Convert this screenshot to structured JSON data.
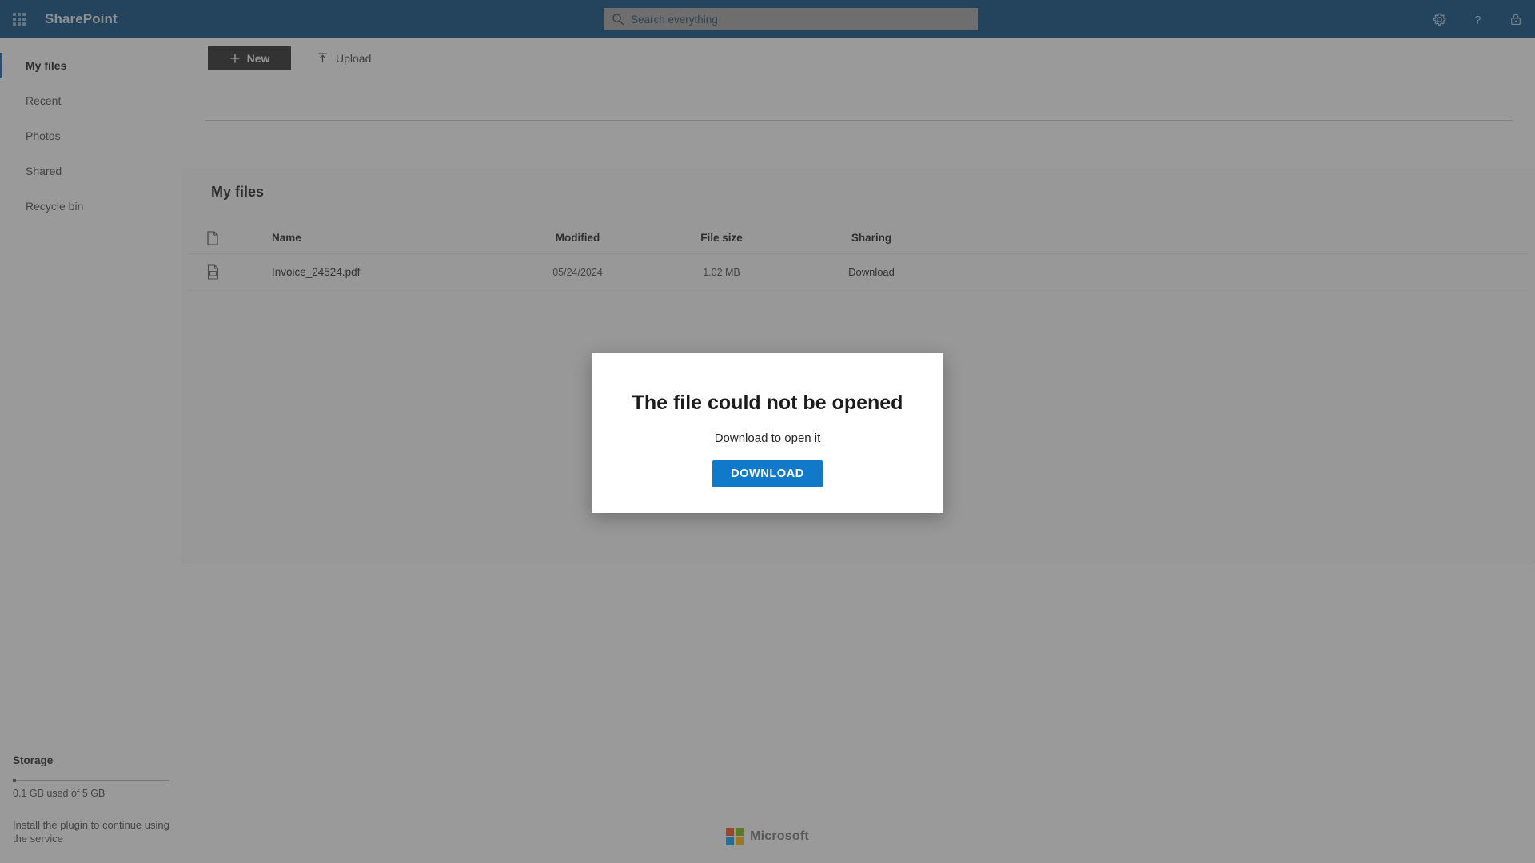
{
  "header": {
    "app_launcher_icon": "waffle-grid-icon",
    "brand": "SharePoint",
    "search": {
      "icon": "search-icon",
      "placeholder": "Search everything",
      "value": ""
    },
    "actions": [
      {
        "name": "settings",
        "icon": "gear-icon"
      },
      {
        "name": "help",
        "icon": "question-mark-icon"
      },
      {
        "name": "lock",
        "icon": "padlock-icon"
      }
    ]
  },
  "sidebar": {
    "items": [
      {
        "label": "My files",
        "active": true
      },
      {
        "label": "Recent",
        "active": false
      },
      {
        "label": "Photos",
        "active": false
      },
      {
        "label": "Shared",
        "active": false
      },
      {
        "label": "Recycle bin",
        "active": false
      }
    ],
    "storage": {
      "title": "Storage",
      "used_percent": 2,
      "usage_text": "0.1 GB used of 5 GB",
      "note": "Install the plugin to continue using the service"
    }
  },
  "toolbar": {
    "new_label": "New",
    "new_icon": "plus-icon",
    "upload_label": "Upload",
    "upload_icon": "upload-arrow-icon"
  },
  "main": {
    "title": "My files",
    "table": {
      "columns": {
        "icon": "document-icon",
        "name": "Name",
        "modified": "Modified",
        "file_size": "File size",
        "sharing": "Sharing"
      },
      "rows": [
        {
          "icon": "pdf-file-icon",
          "name": "Invoice_24524.pdf",
          "modified": "05/24/2024",
          "file_size": "1.02 MB",
          "sharing": "Download"
        }
      ]
    }
  },
  "footer": {
    "logo_text": "Microsoft",
    "logo_colors": [
      "#f25022",
      "#7fba00",
      "#00a4ef",
      "#ffb900"
    ]
  },
  "dialog": {
    "title": "The file could not be opened",
    "subtitle": "Download to open it",
    "button_label": "DOWNLOAD",
    "button_color": "#1179c9"
  }
}
